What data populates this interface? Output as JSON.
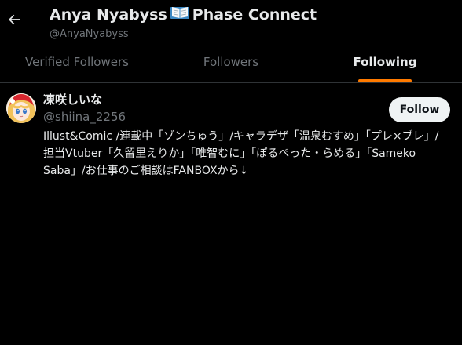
{
  "header": {
    "name_part1": "Anya Nyabyss",
    "name_part2": "Phase Connect",
    "book_icon": "open-book-emoji",
    "handle": "@AnyaNyabyss"
  },
  "tabs": [
    {
      "label": "Verified Followers",
      "active": false
    },
    {
      "label": "Followers",
      "active": false
    },
    {
      "label": "Following",
      "active": true
    }
  ],
  "accent_color": "#ff7a00",
  "users": [
    {
      "name": "凍咲しいな",
      "handle": "@shiina_2256",
      "follow_label": "Follow",
      "bio": "Illust&Comic /連載中「ゾンちゅう」/キャラデザ「温泉むすめ」「プレ×ブレ」/担当Vtuber「久留里えりか」「唯智むに」「ぽるぺった・らめる」「Sameko Saba」/お仕事のご相談はFANBOXから↓"
    }
  ]
}
